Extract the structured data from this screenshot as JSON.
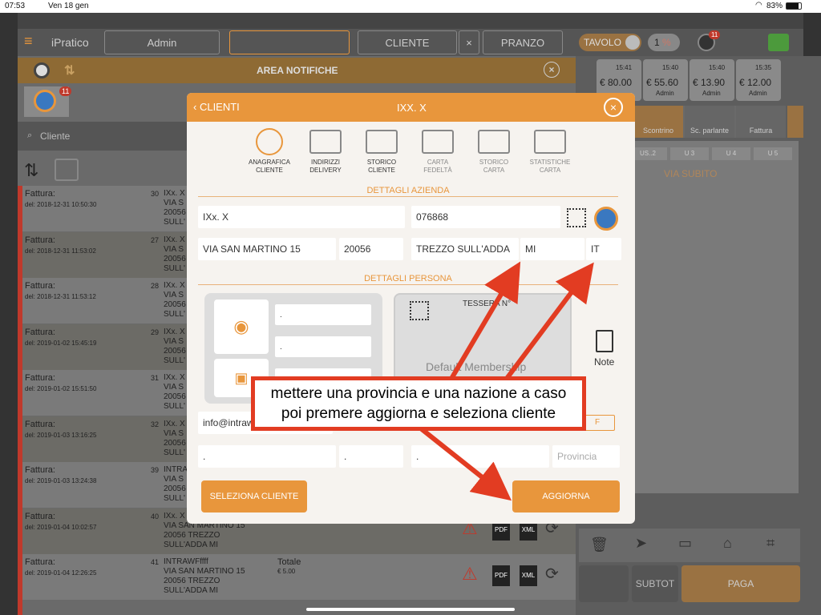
{
  "status": {
    "time": "07:53",
    "date": "Ven 18 gen",
    "battery": "83%"
  },
  "topbar": {
    "brand": "iPratico",
    "admin": "Admin",
    "cliente": "CLIENTE",
    "clear": "×",
    "pranzo": "PRANZO",
    "tavolo": "TAVOLO",
    "covers": "1",
    "percent": "%",
    "globe_badge": "11"
  },
  "notifications": {
    "title": "AREA NOTIFICHE",
    "badge": "11"
  },
  "search": {
    "placeholder": "Cliente"
  },
  "tickets": [
    {
      "time": "15:41",
      "amount": "€ 80.00",
      "user": ""
    },
    {
      "time": "15:40",
      "amount": "€ 55.60",
      "user": "Admin"
    },
    {
      "time": "15:40",
      "amount": "€ 13.90",
      "user": "Admin"
    },
    {
      "time": "15:35",
      "amount": "€ 12.00",
      "user": "Admin"
    }
  ],
  "doc_tabs": [
    "Scontrino",
    "Sc. parlante",
    "Fattura"
  ],
  "course_tabs": [
    "US..2",
    "U 3",
    "U 4",
    "U 5"
  ],
  "via_subito": "VIA SUBITO",
  "invoices": [
    {
      "label": "Fattura:",
      "date": "del: 2018-12-31 10:50:30",
      "num": "30",
      "addr": "IXx. X\nVIA S\n20056\nSULL'",
      "total_label": "",
      "total": ""
    },
    {
      "label": "Fattura:",
      "date": "del: 2018-12-31 11:53:02",
      "num": "27",
      "addr": "IXx. X\nVIA S\n20056\nSULL'",
      "total_label": "",
      "total": ""
    },
    {
      "label": "Fattura:",
      "date": "del: 2018-12-31 11:53:12",
      "num": "28",
      "addr": "IXx. X\nVIA S\n20056\nSULL'",
      "total_label": "",
      "total": ""
    },
    {
      "label": "Fattura:",
      "date": "del: 2019-01-02 15:45:19",
      "num": "29",
      "addr": "IXx. X\nVIA S\n20056\nSULL'",
      "total_label": "",
      "total": ""
    },
    {
      "label": "Fattura:",
      "date": "del: 2019-01-02 15:51:50",
      "num": "31",
      "addr": "IXx. X\nVIA S\n20056\nSULL'",
      "total_label": "",
      "total": ""
    },
    {
      "label": "Fattura:",
      "date": "del: 2019-01-03 13:16:25",
      "num": "32",
      "addr": "IXx. X\nVIA S\n20056\nSULL'",
      "total_label": "",
      "total": ""
    },
    {
      "label": "Fattura:",
      "date": "del: 2019-01-03 13:24:38",
      "num": "39",
      "addr": "INTRA\nVIA S\n20056\nSULL'",
      "total_label": "",
      "total": ""
    },
    {
      "label": "Fattura:",
      "date": "del: 2019-01-04 10:02:57",
      "num": "40",
      "addr": "IXx. X\nVIA SAN MARTINO 15\n20056 TREZZO\nSULL'ADDA MI",
      "total_label": "",
      "total": ""
    },
    {
      "label": "Fattura:",
      "date": "del: 2019-01-04 12:26:25",
      "num": "41",
      "addr": "INTRAWFffff\nVIA SAN MARTINO 15\n20056 TREZZO\nSULL'ADDA MI",
      "total_label": "Totale",
      "total": "€ 5.00"
    }
  ],
  "action_labels": {
    "pdf": "PDF",
    "xml": "XML"
  },
  "bottom_right": {
    "subtot": "SUBTOT",
    "paga": "PAGA"
  },
  "modal": {
    "back": "CLIENTI",
    "title": "IXX. X",
    "tabs": [
      {
        "label": "ANAGRAFICA\nCLIENTE",
        "icon": "person-icon"
      },
      {
        "label": "INDIRIZZI\nDELIVERY",
        "icon": "scooter-icon"
      },
      {
        "label": "STORICO\nCLIENTE",
        "icon": "trend-icon"
      },
      {
        "label": "CARTA\nFEDELTÀ",
        "icon": "card-icon"
      },
      {
        "label": "STORICO\nCARTA",
        "icon": "list-icon"
      },
      {
        "label": "STATISTICHE\nCARTA",
        "icon": "stats-icon"
      }
    ],
    "section_company": "DETTAGLI AZIENDA",
    "company_name": "IXx. X",
    "vat": "076868",
    "street": "VIA SAN MARTINO 15",
    "cap": "20056",
    "city": "TREZZO SULL'ADDA",
    "province": "MI",
    "country": "IT",
    "section_person": "DETTAGLI PERSONA",
    "person_fields": [
      ".",
      ".",
      "."
    ],
    "card_title": "TESSERA N°",
    "card_type": "Default Membership",
    "note": "Note",
    "email": "info@intrawebit",
    "gender_f": "F",
    "dot1": ".",
    "dot2": ".",
    "dot3": ".",
    "province_placeholder": "Provincia",
    "select_btn": "SELEZIONA CLIENTE",
    "update_btn": "AGGIORNA"
  },
  "callout": {
    "line1": "mettere una provincia e una nazione a caso",
    "line2": "poi premere aggiorna e seleziona cliente"
  },
  "colors": {
    "accent": "#e8963c",
    "arrow": "#e23c22"
  }
}
